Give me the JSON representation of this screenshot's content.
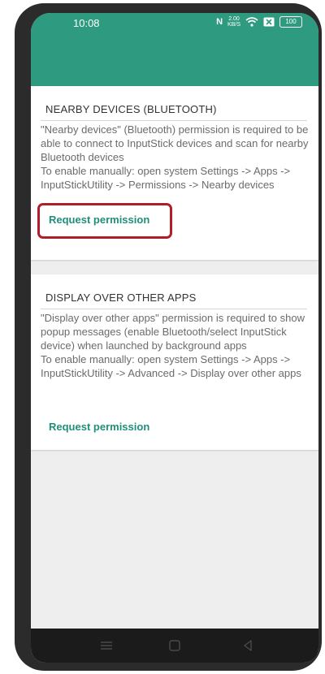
{
  "status_bar": {
    "time": "10:08",
    "nfc": "N",
    "net_speed_value": "2.00",
    "net_speed_unit": "KB/S",
    "battery": "100"
  },
  "colors": {
    "accent": "#2e9b80",
    "link": "#1f8f79",
    "highlight": "#b01e2a"
  },
  "sections": [
    {
      "title": "NEARBY DEVICES (BLUETOOTH)",
      "description": "\"Nearby devices\" (Bluetooth) permission is required to be able to connect to InputStick devices and scan for nearby Bluetooth devices",
      "instructions": "To enable manually: open system Settings -> Apps -> InputStickUtility -> Permissions -> Nearby devices",
      "button_label": "Request permission"
    },
    {
      "title": "DISPLAY OVER OTHER APPS",
      "description": "\"Display over other apps\" permission is required to show popup messages (enable Bluetooth/select InputStick device) when launched by background apps",
      "instructions": "To enable manually: open system Settings -> Apps -> InputStickUtility -> Advanced -> Display over other apps",
      "button_label": "Request permission"
    }
  ],
  "nav_bar": {
    "icons": [
      "menu-icon",
      "home-icon",
      "back-icon"
    ]
  }
}
